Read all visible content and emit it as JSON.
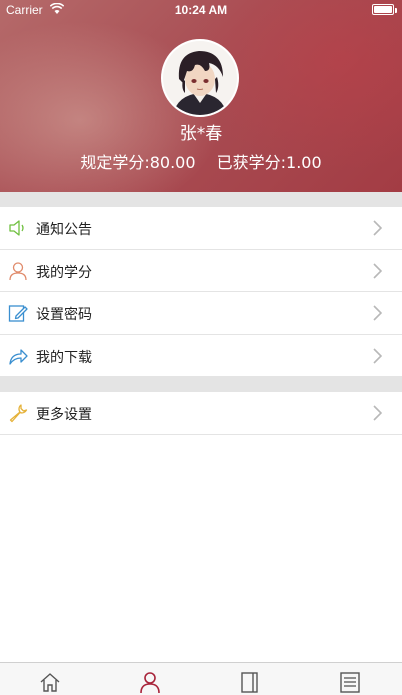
{
  "status_bar": {
    "carrier": "Carrier",
    "time": "10:24 AM"
  },
  "profile": {
    "name": "张*春",
    "required_credits": "规定学分:80.00",
    "earned_credits": "已获学分:1.00"
  },
  "menu_group_1": [
    {
      "label": "通知公告",
      "icon": "speaker-icon",
      "color": "#6fbf3f"
    },
    {
      "label": "我的学分",
      "icon": "user-icon",
      "color": "#e08a6a"
    },
    {
      "label": "设置密码",
      "icon": "edit-icon",
      "color": "#3a8fd0"
    },
    {
      "label": "我的下载",
      "icon": "share-icon",
      "color": "#3a8fd0"
    }
  ],
  "menu_group_2": [
    {
      "label": "更多设置",
      "icon": "wrench-icon",
      "color": "#e5b23a"
    }
  ],
  "tabbar": {
    "tabs": [
      "home-icon",
      "profile-icon",
      "book-icon",
      "list-icon"
    ],
    "active_index": 1,
    "active_color": "#a8243a"
  },
  "colors": {
    "header_accent": "#a94e54",
    "separator": "#e4e4e4"
  }
}
